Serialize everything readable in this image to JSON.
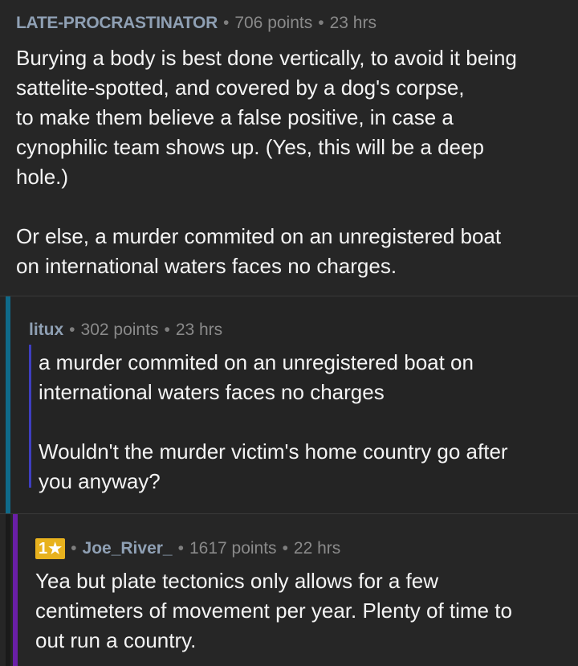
{
  "comments": [
    {
      "author": "LATE-PROCRASTINATOR",
      "points": "706 points",
      "age": "23 hrs",
      "separator": "•",
      "body": "Burying a body is best done vertically, to avoid it being\nsattelite-spotted, and covered by a dog's corpse,\nto make them believe a false positive, in case a\ncynophilic team shows up. (Yes, this will be a deep\nhole.)\n\nOr else, a murder commited on an unregistered boat\non international waters faces no charges."
    },
    {
      "author": "litux",
      "points": "302 points",
      "age": "23 hrs",
      "separator": "•",
      "body": "a murder commited on an unregistered boat on\ninternational waters faces no charges\n\nWouldn't the murder victim's home country go after\nyou anyway?"
    },
    {
      "badge_count": "1",
      "badge_icon": "star-icon",
      "author": "Joe_River_",
      "points": "1617 points",
      "age": "22 hrs",
      "separator": "•",
      "body": "Yea but plate tectonics only allows for a few\ncentimeters of movement per year. Plenty of time to\nout run a country."
    }
  ],
  "colors": {
    "background": "#262626",
    "author": "#8fa0b4",
    "meta": "#8a8a8a",
    "thread_level_1": "#0f6a8a",
    "thread_level_2": "#6a1fa8",
    "quote_bar": "#3e3ec0",
    "badge": "#e8b21e"
  }
}
